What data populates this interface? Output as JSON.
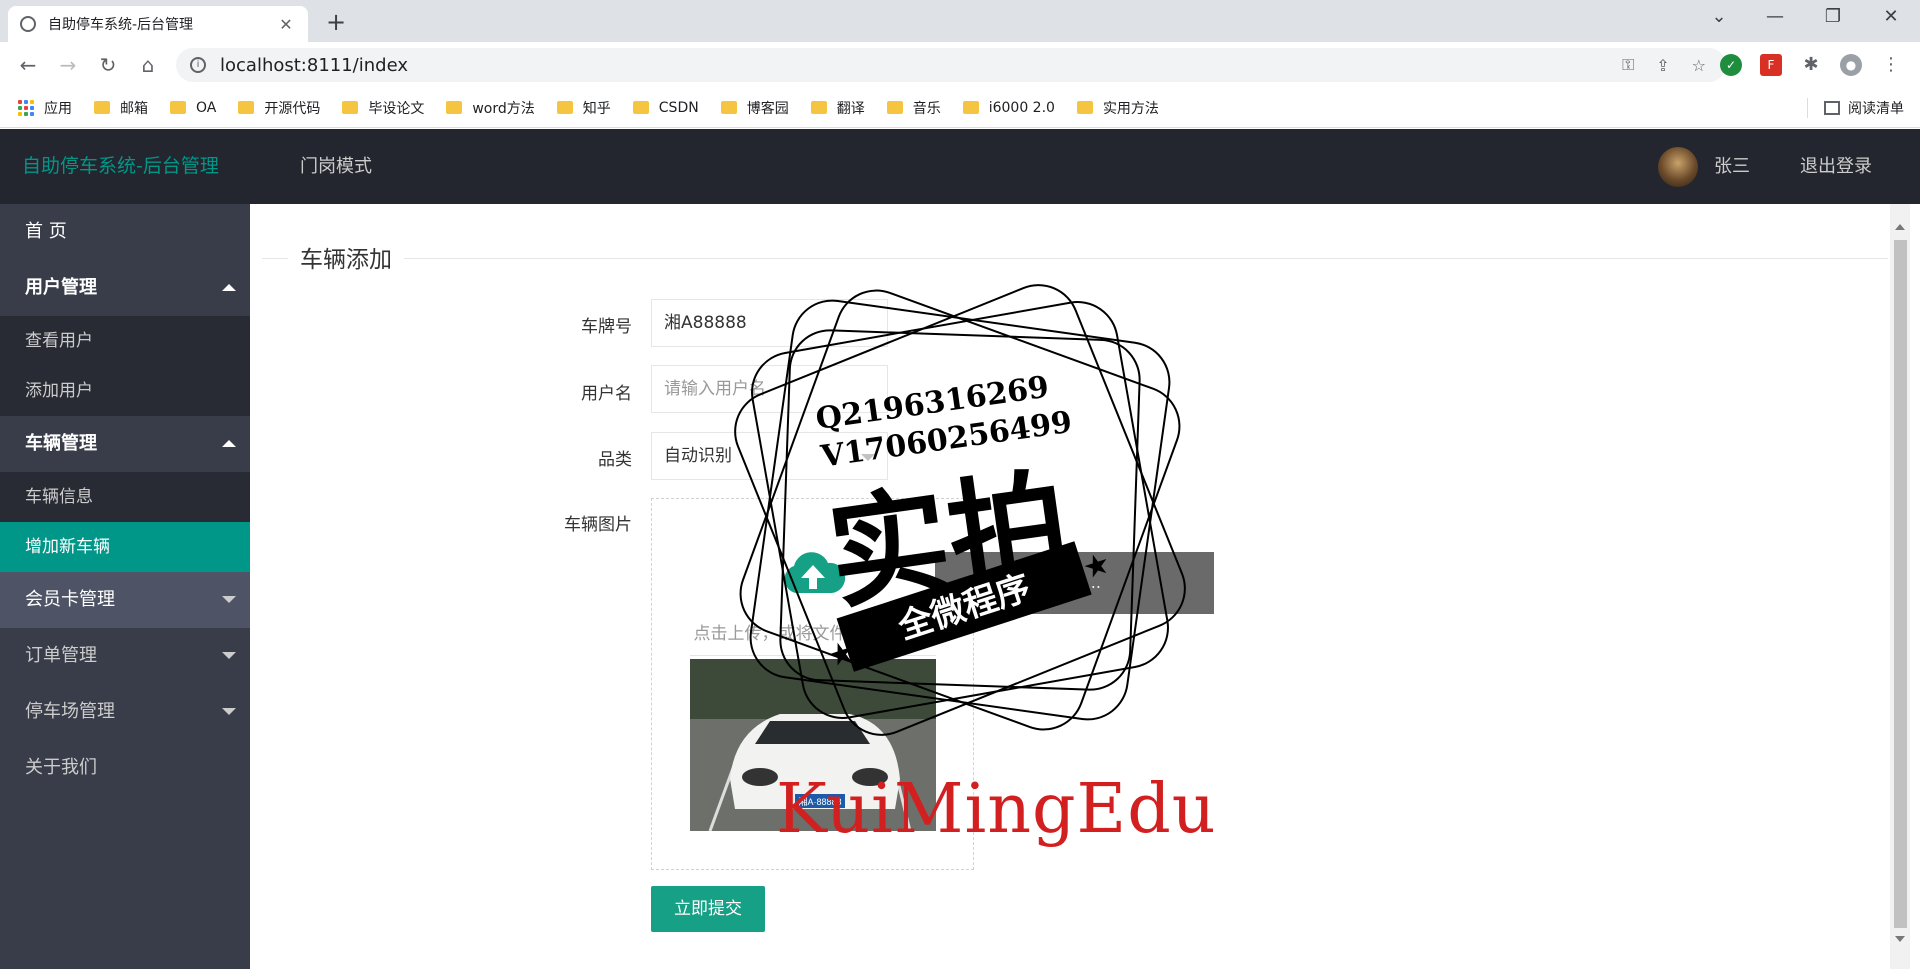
{
  "browser": {
    "tab_title": "自助停车系统-后台管理",
    "url": "localhost:8111/index",
    "bookmarks": [
      "应用",
      "邮箱",
      "OA",
      "开源代码",
      "毕设论文",
      "word方法",
      "知乎",
      "CSDN",
      "博客园",
      "翻译",
      "音乐",
      "i6000 2.0",
      "实用方法"
    ],
    "reading_list": "阅读清单"
  },
  "header": {
    "logo": "自助停车系统-后台管理",
    "nav_mode": "门岗模式",
    "user_name": "张三",
    "logout": "退出登录"
  },
  "sidebar": {
    "home": "首 页",
    "user_mgmt": "用户管理",
    "view_users": "查看用户",
    "add_user": "添加用户",
    "vehicle_mgmt": "车辆管理",
    "vehicle_info": "车辆信息",
    "add_vehicle": "增加新车辆",
    "member_card": "会员卡管理",
    "order_mgmt": "订单管理",
    "parking_mgmt": "停车场管理",
    "about": "关于我们"
  },
  "form": {
    "legend": "车辆添加",
    "plate_label": "车牌号",
    "plate_value": "湘A88888",
    "username_label": "用户名",
    "username_placeholder": "请输入用户名",
    "category_label": "品类",
    "category_value": "自动识别",
    "image_label": "车辆图片",
    "upload_hint": "点击上传，或将文件拖拽到此处",
    "submit": "立即提交",
    "tooltip": "车辆... 实... 详情..."
  },
  "watermark": {
    "qq": "Q2196316269",
    "vx": "V17060256499",
    "big": "实拍",
    "banner": "全微程序",
    "brand": "KuiMingEdu"
  },
  "colors": {
    "accent": "#009688",
    "header_bg": "#23262e",
    "sidebar_bg": "#393d49",
    "submit": "#16a085",
    "brand_red": "#d21f1f"
  }
}
